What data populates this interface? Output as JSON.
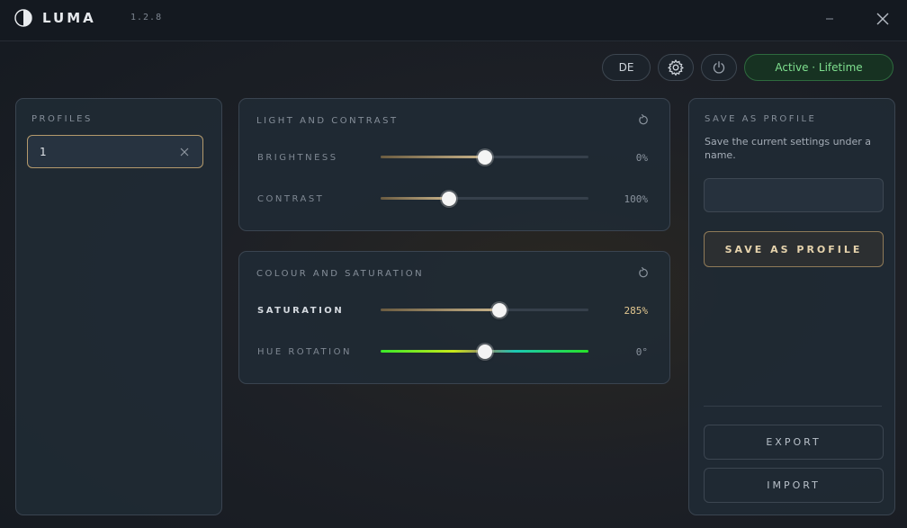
{
  "app": {
    "name": "LUMA",
    "version": "1.2.8"
  },
  "toolbar": {
    "language": "DE",
    "status": "Active · Lifetime"
  },
  "profiles": {
    "title": "PROFILES",
    "items": [
      {
        "name": "1"
      }
    ]
  },
  "light_contrast": {
    "title": "LIGHT AND CONTRAST",
    "sliders": [
      {
        "label": "BRIGHTNESS",
        "value": "0%",
        "position": 0.5
      },
      {
        "label": "CONTRAST",
        "value": "100%",
        "position": 0.33
      }
    ]
  },
  "colour_saturation": {
    "title": "COLOUR AND SATURATION",
    "sliders": [
      {
        "label": "SATURATION",
        "value": "285%",
        "position": 0.57
      },
      {
        "label": "HUE ROTATION",
        "value": "0°",
        "position": 0.5
      }
    ]
  },
  "save_profile": {
    "title": "SAVE AS PROFILE",
    "description": "Save the current settings under a name.",
    "input_value": "",
    "input_placeholder": "",
    "save_label": "SAVE AS PROFILE",
    "export_label": "EXPORT",
    "import_label": "IMPORT"
  },
  "colors": {
    "accent_gold": "#b49a6c",
    "status_green": "#7fe08f",
    "panel_bg": "#202a34"
  }
}
